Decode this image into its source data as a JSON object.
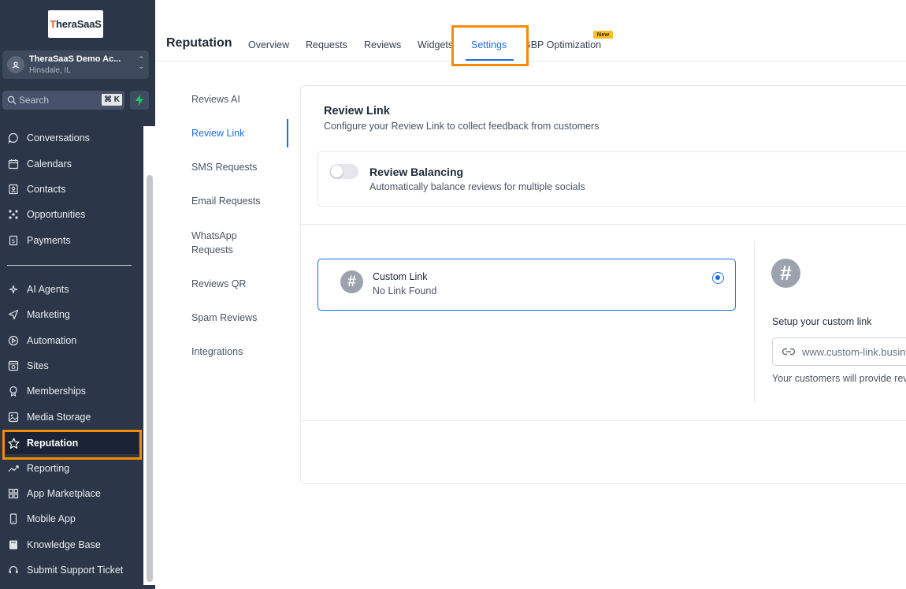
{
  "brand": {
    "logo_text_a": "T",
    "logo_text_b": "heraSaaS"
  },
  "account": {
    "name": "TheraSaaS Demo Ac...",
    "location": "Hinsdale, IL"
  },
  "search": {
    "placeholder": "Search",
    "shortcut": "⌘ K"
  },
  "sidebar": {
    "items": [
      {
        "label": "Conversations",
        "icon": "chat-bubble-icon"
      },
      {
        "label": "Calendars",
        "icon": "calendar-icon"
      },
      {
        "label": "Contacts",
        "icon": "contacts-icon"
      },
      {
        "label": "Opportunities",
        "icon": "opportunities-icon"
      },
      {
        "label": "Payments",
        "icon": "payments-icon"
      },
      {
        "label": "AI Agents",
        "icon": "sparkle-icon"
      },
      {
        "label": "Marketing",
        "icon": "send-icon"
      },
      {
        "label": "Automation",
        "icon": "automation-icon"
      },
      {
        "label": "Sites",
        "icon": "sites-icon"
      },
      {
        "label": "Memberships",
        "icon": "badge-icon"
      },
      {
        "label": "Media Storage",
        "icon": "image-icon"
      },
      {
        "label": "Reputation",
        "icon": "star-icon"
      },
      {
        "label": "Reporting",
        "icon": "trend-icon"
      },
      {
        "label": "App Marketplace",
        "icon": "grid-icon"
      },
      {
        "label": "Mobile App",
        "icon": "mobile-icon"
      },
      {
        "label": "Knowledge Base",
        "icon": "book-icon"
      },
      {
        "label": "Submit Support Ticket",
        "icon": "headset-icon"
      }
    ],
    "active": "Reputation"
  },
  "header": {
    "title": "Reputation",
    "tabs": [
      {
        "label": "Overview"
      },
      {
        "label": "Requests"
      },
      {
        "label": "Reviews"
      },
      {
        "label": "Widgets"
      },
      {
        "label": "Settings"
      },
      {
        "label": "GBP Optimization"
      }
    ],
    "active_tab": "Settings",
    "new_badge": "New"
  },
  "settings_menu": {
    "items": [
      {
        "label": "Reviews AI"
      },
      {
        "label": "Review Link"
      },
      {
        "label": "SMS Requests"
      },
      {
        "label": "Email Requests"
      },
      {
        "label": "WhatsApp Requests"
      },
      {
        "label": "Reviews QR"
      },
      {
        "label": "Spam Reviews"
      },
      {
        "label": "Integrations"
      }
    ],
    "active": "Review Link"
  },
  "review_link": {
    "title": "Review Link",
    "subtitle": "Configure your Review Link to collect feedback from customers",
    "balancing": {
      "title": "Review Balancing",
      "subtitle": "Automatically balance reviews for multiple socials",
      "enabled": false
    },
    "option": {
      "title": "Custom Link",
      "subtitle": "No Link Found",
      "selected": true
    },
    "setup": {
      "label": "Setup your custom link",
      "placeholder": "www.custom-link.business",
      "helper": "Your customers will provide reviews here"
    }
  },
  "colors": {
    "accent": "#1d6fe0",
    "highlight": "#f58a07",
    "sidebar_bg": "#2b3648"
  }
}
